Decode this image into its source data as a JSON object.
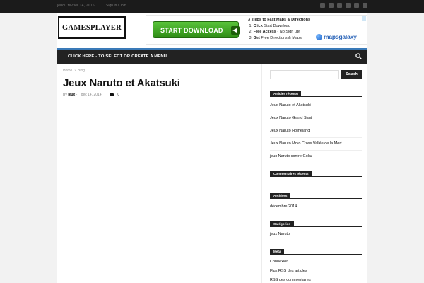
{
  "topbar": {
    "date": "jeudi, février 14, 2016",
    "login": "Sign in / Join"
  },
  "header": {
    "logo_text": "GAMESPLAYER",
    "ad": {
      "button_label": "START DOWNLOAD",
      "headline": "3 steps to Fast Maps & Directions",
      "steps": [
        {
          "num": "1.",
          "bold": "Click",
          "rest": " Start Download"
        },
        {
          "num": "2.",
          "bold": "Free Access",
          "rest": " - No Sign up!"
        },
        {
          "num": "3.",
          "bold": "Get",
          "rest": " Free Directions & Maps"
        }
      ],
      "brand": "mapsgalaxy"
    }
  },
  "menu": {
    "label": "CLICK HERE - TO SELECT OR CREATE A MENU"
  },
  "breadcrumb": {
    "home": "Home",
    "separator": "›",
    "current": "Blog"
  },
  "post": {
    "title": "Jeux Naruto et Akatsuki",
    "by": "By",
    "author": "jeux",
    "dash": "-",
    "date": "déc 14, 2014",
    "comments": "0"
  },
  "sidebar": {
    "search_button": "Search",
    "recent_articles": {
      "title": "Articles récents",
      "items": [
        "Jeux Naruto et Akatsuki",
        "Jeux Naruto Grand Saut",
        "Jeux Naruto Homeland",
        "Jeux Naruto Moto Cross Vallée de la Mort",
        "jeux Naruto contre Goku"
      ]
    },
    "recent_comments": {
      "title": "Commentaires récents"
    },
    "archives": {
      "title": "Archives",
      "items": [
        "décembre 2014"
      ]
    },
    "categories": {
      "title": "Catégories",
      "items": [
        "jeux Naruto"
      ]
    },
    "meta": {
      "title": "Méta",
      "items": [
        "Connexion",
        "Flux RSS des articles",
        "RSS des commentaires"
      ]
    }
  },
  "colors": {
    "menu_bg": "#222222",
    "menu_accent": "#3a7ab8",
    "ad_button_green": "#3aa11f"
  }
}
